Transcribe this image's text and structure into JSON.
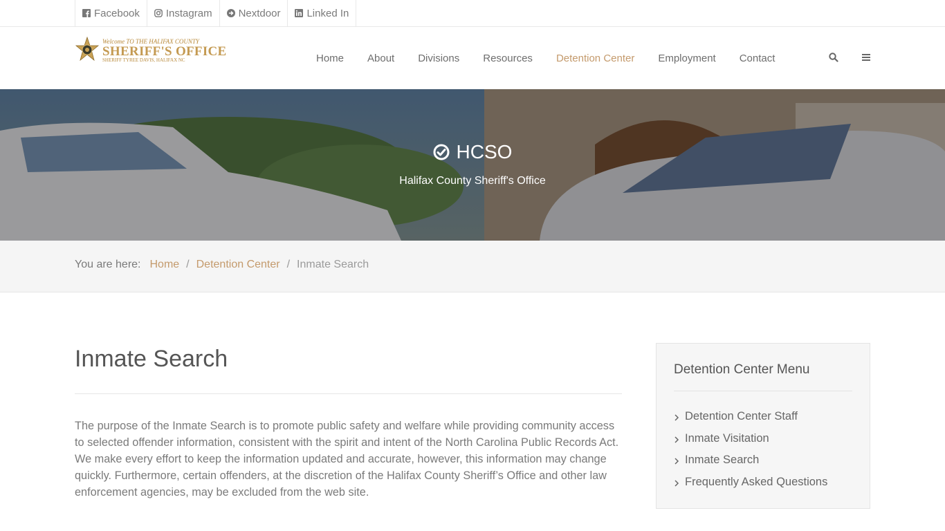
{
  "social": [
    {
      "label": "Facebook",
      "icon": "facebook-icon"
    },
    {
      "label": "Instagram",
      "icon": "instagram-icon"
    },
    {
      "label": "Nextdoor",
      "icon": "arrow-circle-icon"
    },
    {
      "label": "Linked In",
      "icon": "linkedin-icon"
    }
  ],
  "logo": {
    "line1": "Welcome TO THE HALIFAX COUNTY",
    "line2": "SHERIFF'S OFFICE",
    "line3": "SHERIFF TYREE DAVIS, HALIFAX NC"
  },
  "nav": [
    {
      "label": "Home",
      "active": false
    },
    {
      "label": "About",
      "active": false
    },
    {
      "label": "Divisions",
      "active": false
    },
    {
      "label": "Resources",
      "active": false
    },
    {
      "label": "Detention Center",
      "active": true
    },
    {
      "label": "Employment",
      "active": false
    },
    {
      "label": "Contact",
      "active": false
    }
  ],
  "hero": {
    "title": "HCSO",
    "subtitle": "Halifax County Sheriff's Office"
  },
  "breadcrumb": {
    "prefix": "You are here:",
    "items": [
      "Home",
      "Detention Center"
    ],
    "current": "Inmate Search"
  },
  "main": {
    "title": "Inmate Search",
    "body": "The purpose of the Inmate Search is to promote public safety and welfare while providing community access to selected offender information, consistent with the spirit and intent of the North Carolina Public Records Act. We make every effort to keep the information updated and accurate, however, this information may change quickly. Furthermore, certain offenders, at the discretion of the Halifax County Sheriff’s Office and other law enforcement agencies, may be excluded from the web site."
  },
  "sidebar": {
    "title": "Detention Center Menu",
    "items": [
      "Detention Center Staff",
      "Inmate Visitation",
      "Inmate Search",
      "Frequently Asked Questions"
    ]
  },
  "colors": {
    "accent": "#c49a6c",
    "text": "#6b6b6b"
  }
}
